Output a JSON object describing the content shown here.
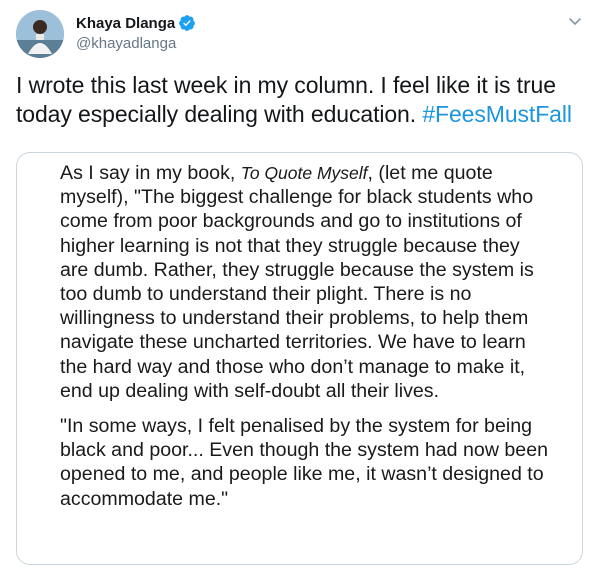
{
  "tweet": {
    "author": {
      "display_name": "Khaya Dlanga",
      "handle": "@khayadlanga",
      "verified": true,
      "avatar": "avatar-photo"
    },
    "text_before": "I wrote this last week in my column. I feel like it is true today especially dealing with education. ",
    "hashtag": "#FeesMustFall",
    "menu_icon": "chevron-down-icon",
    "colors": {
      "hashtag": "#1b95e0",
      "verified": "#1da1f2",
      "secondary_text": "#657786",
      "card_border": "#ccd6dd"
    }
  },
  "media": {
    "paragraph1": {
      "lead": "As I say in my book, ",
      "book_title": "To Quote Myself",
      "rest": ", (let me quote myself), \"The biggest challenge for black students who come from poor backgrounds and go to institutions of higher learning is not that they struggle because they are dumb. Rather, they struggle because the system is too dumb to understand their plight. There is no willingness to understand their problems, to help them navigate these uncharted territories. We have to learn the hard way and those who don’t manage to make it, end up dealing with self-doubt all their lives."
    },
    "paragraph2": "\"In some ways, I felt penalised by the system for being black and poor... Even though the system had now been opened to me, and people like me, it wasn’t designed to accommodate me.\""
  }
}
